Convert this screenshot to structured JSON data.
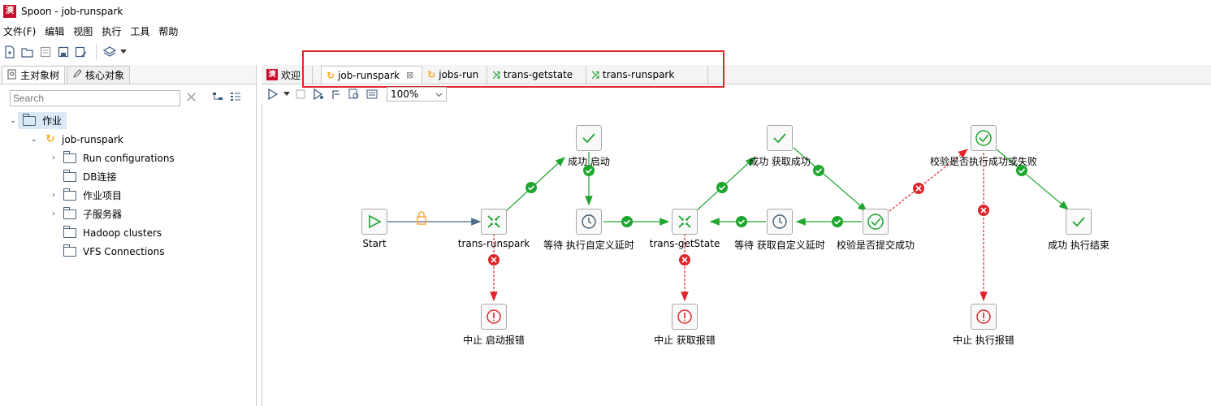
{
  "app": {
    "title": "Spoon - job-runspark",
    "icon_text": "漺"
  },
  "menu": [
    "文件(F)",
    "编辑",
    "视图",
    "执行",
    "工具",
    "帮助"
  ],
  "left": {
    "tabs": [
      {
        "label": "主对象树",
        "icon": "tree-search-icon"
      },
      {
        "label": "核心对象",
        "icon": "pencil-icon"
      }
    ],
    "search_placeholder": "Search",
    "tree": {
      "root": "作业",
      "job": "job-runspark",
      "children": [
        {
          "label": "Run configurations",
          "expandable": true
        },
        {
          "label": "DB连接",
          "expandable": false
        },
        {
          "label": "作业项目",
          "expandable": true
        },
        {
          "label": "子服务器",
          "expandable": true
        },
        {
          "label": "Hadoop clusters",
          "expandable": false
        },
        {
          "label": "VFS Connections",
          "expandable": false
        }
      ]
    }
  },
  "editor": {
    "welcome_tab": "欢迎",
    "tabs": [
      {
        "label": "job-runspark",
        "kind": "job",
        "active": true
      },
      {
        "label": "jobs-run",
        "kind": "job",
        "active": false
      },
      {
        "label": "trans-getstate",
        "kind": "trans",
        "active": false
      },
      {
        "label": "trans-runspark",
        "kind": "trans",
        "active": false
      }
    ],
    "zoom": "100%"
  },
  "nodes": {
    "start": "Start",
    "trans_runspark": "trans-runspark",
    "success_start": "成功 启动",
    "wait_custom": "等待 执行自定义延时",
    "trans_getstate": "trans-getState",
    "success_get": "成功 获取成功",
    "wait_get": "等待 获取自定义延时",
    "check_submit": "校验是否提交成功",
    "check_exec": "校验是否执行成功或失败",
    "success_end": "成功 执行结束",
    "abort_start": "中止 启动报错",
    "abort_get": "中止 获取报错",
    "abort_exec": "中止 执行报错"
  },
  "colors": {
    "success": "#1fa62f",
    "error": "#e0242a",
    "unconditional": "#4a6a8a",
    "highlight": "#e0242a"
  }
}
